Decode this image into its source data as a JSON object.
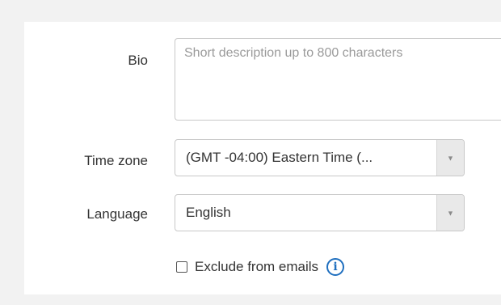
{
  "form": {
    "bio": {
      "label": "Bio",
      "placeholder": "Short description up to 800 characters",
      "value": ""
    },
    "time_zone": {
      "label": "Time zone",
      "selected": "(GMT -04:00) Eastern Time (..."
    },
    "language": {
      "label": "Language",
      "selected": "English"
    },
    "exclude_emails": {
      "label": "Exclude from emails",
      "checked": false
    }
  },
  "icons": {
    "dropdown": "chevron-down-icon",
    "info": "info-icon"
  },
  "colors": {
    "info": "#1f6fbf",
    "background": "#f2f2f2",
    "panel": "#ffffff"
  }
}
